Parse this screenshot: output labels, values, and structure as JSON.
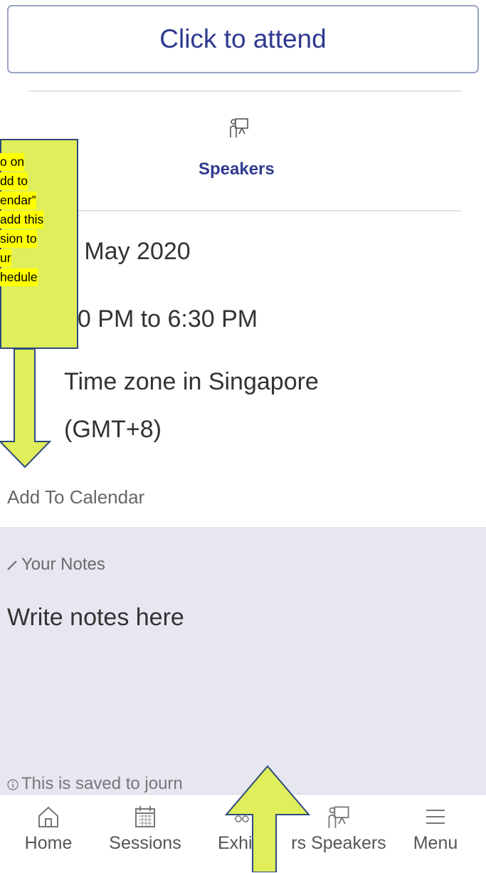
{
  "attend_button": {
    "label": "Click to attend"
  },
  "speakers_link": {
    "label": "Speakers",
    "icon": "presenter-icon"
  },
  "session": {
    "date": "6 May 2020",
    "time": "00 PM to 6:30 PM",
    "timezone_line1": "Time zone in Singapore",
    "timezone_line2": "(GMT+8)"
  },
  "add_to_calendar": {
    "label": "Add To Calendar"
  },
  "notes": {
    "label": "Your Notes",
    "placeholder": "Write notes here",
    "saved_info": "This is saved to journ"
  },
  "callout": {
    "lines": [
      "o on",
      "dd to",
      "endar”",
      "add this",
      "sion to",
      "ur",
      "hedule"
    ]
  },
  "tabs": [
    {
      "label": "Home",
      "icon": "home-icon"
    },
    {
      "label": "Sessions",
      "icon": "calendar-icon"
    },
    {
      "label": "Exhibi",
      "icon": "exhibitors-icon"
    },
    {
      "label": "rs Speakers",
      "icon": "presenter-icon"
    },
    {
      "label": "Menu",
      "icon": "menu-icon"
    }
  ],
  "colors": {
    "accent": "#2f3a8f",
    "notes_bg": "#e6e7f1",
    "callout_fill": "#dfee5a",
    "highlight": "#ffff00",
    "arrow_stroke": "#2e4a7d"
  }
}
